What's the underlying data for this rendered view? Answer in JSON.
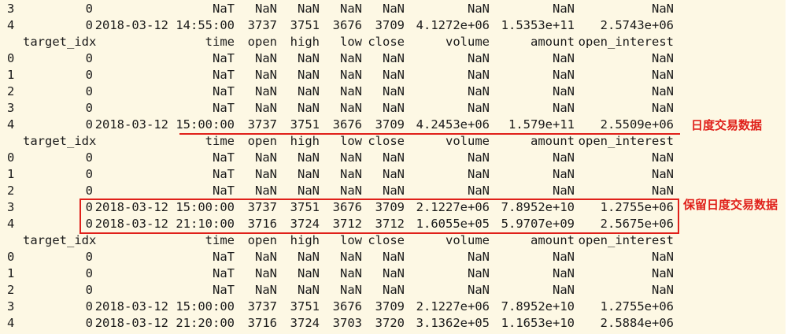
{
  "columns": [
    "target_idx",
    "time",
    "open",
    "high",
    "low",
    "close",
    "volume",
    "amount",
    "open_interest"
  ],
  "annotations": {
    "daily_data": "日度交易数据",
    "keep_daily_data": "保留日度交易数据"
  },
  "colors": {
    "annotation_red": "#e0201a",
    "console_bg": "#fdf8e4"
  },
  "rows": [
    {
      "type": "data",
      "cells": [
        "3",
        "0",
        "NaT",
        "NaN",
        "NaN",
        "NaN",
        "NaN",
        "NaN",
        "NaN",
        "NaN"
      ]
    },
    {
      "type": "data",
      "cells": [
        "4",
        "0",
        "2018-03-12 14:55:00",
        "3737",
        "3751",
        "3676",
        "3709",
        "4.1272e+06",
        "1.5353e+11",
        "2.5743e+06"
      ]
    },
    {
      "type": "header"
    },
    {
      "type": "data",
      "cells": [
        "0",
        "0",
        "NaT",
        "NaN",
        "NaN",
        "NaN",
        "NaN",
        "NaN",
        "NaN",
        "NaN"
      ]
    },
    {
      "type": "data",
      "cells": [
        "1",
        "0",
        "NaT",
        "NaN",
        "NaN",
        "NaN",
        "NaN",
        "NaN",
        "NaN",
        "NaN"
      ]
    },
    {
      "type": "data",
      "cells": [
        "2",
        "0",
        "NaT",
        "NaN",
        "NaN",
        "NaN",
        "NaN",
        "NaN",
        "NaN",
        "NaN"
      ]
    },
    {
      "type": "data",
      "cells": [
        "3",
        "0",
        "NaT",
        "NaN",
        "NaN",
        "NaN",
        "NaN",
        "NaN",
        "NaN",
        "NaN"
      ]
    },
    {
      "type": "data",
      "cells": [
        "4",
        "0",
        "2018-03-12 15:00:00",
        "3737",
        "3751",
        "3676",
        "3709",
        "4.2453e+06",
        "1.579e+11",
        "2.5509e+06"
      ]
    },
    {
      "type": "header"
    },
    {
      "type": "data",
      "cells": [
        "0",
        "0",
        "NaT",
        "NaN",
        "NaN",
        "NaN",
        "NaN",
        "NaN",
        "NaN",
        "NaN"
      ]
    },
    {
      "type": "data",
      "cells": [
        "1",
        "0",
        "NaT",
        "NaN",
        "NaN",
        "NaN",
        "NaN",
        "NaN",
        "NaN",
        "NaN"
      ]
    },
    {
      "type": "data",
      "cells": [
        "2",
        "0",
        "NaT",
        "NaN",
        "NaN",
        "NaN",
        "NaN",
        "NaN",
        "NaN",
        "NaN"
      ]
    },
    {
      "type": "data",
      "cells": [
        "3",
        "0",
        "2018-03-12 15:00:00",
        "3737",
        "3751",
        "3676",
        "3709",
        "2.1227e+06",
        "7.8952e+10",
        "1.2755e+06"
      ]
    },
    {
      "type": "data",
      "cells": [
        "4",
        "0",
        "2018-03-12 21:10:00",
        "3716",
        "3724",
        "3712",
        "3712",
        "1.6055e+05",
        "5.9707e+09",
        "2.5675e+06"
      ]
    },
    {
      "type": "header"
    },
    {
      "type": "data",
      "cells": [
        "0",
        "0",
        "NaT",
        "NaN",
        "NaN",
        "NaN",
        "NaN",
        "NaN",
        "NaN",
        "NaN"
      ]
    },
    {
      "type": "data",
      "cells": [
        "1",
        "0",
        "NaT",
        "NaN",
        "NaN",
        "NaN",
        "NaN",
        "NaN",
        "NaN",
        "NaN"
      ]
    },
    {
      "type": "data",
      "cells": [
        "2",
        "0",
        "NaT",
        "NaN",
        "NaN",
        "NaN",
        "NaN",
        "NaN",
        "NaN",
        "NaN"
      ]
    },
    {
      "type": "data",
      "cells": [
        "3",
        "0",
        "2018-03-12 15:00:00",
        "3737",
        "3751",
        "3676",
        "3709",
        "2.1227e+06",
        "7.8952e+10",
        "1.2755e+06"
      ]
    },
    {
      "type": "data",
      "cells": [
        "4",
        "0",
        "2018-03-12 21:20:00",
        "3716",
        "3724",
        "3703",
        "3720",
        "3.1362e+05",
        "1.1653e+10",
        "2.5884e+06"
      ]
    }
  ]
}
